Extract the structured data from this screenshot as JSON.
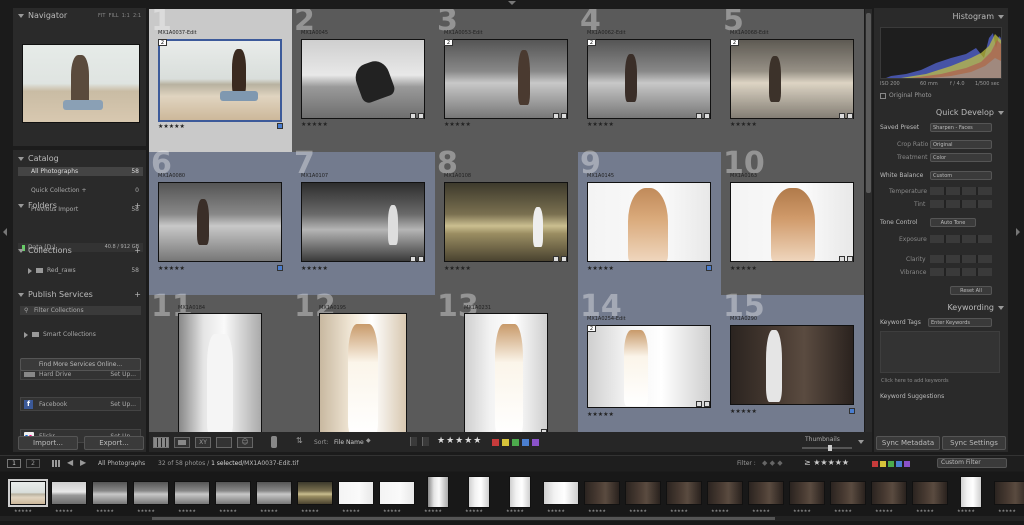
{
  "navigator": {
    "title": "Navigator",
    "fit": "FIT",
    "fill": "FILL",
    "one": "1:1",
    "two": "2:1"
  },
  "catalog": {
    "title": "Catalog",
    "items": [
      {
        "label": "All Photographs",
        "count": "58"
      },
      {
        "label": "Quick Collection +",
        "count": "0"
      },
      {
        "label": "Previous Import",
        "count": "58"
      }
    ]
  },
  "folders": {
    "title": "Folders",
    "drive": "Data (D:)",
    "drive_size": "40.8 / 912 GB",
    "folder": "Red_raws",
    "folder_count": "58"
  },
  "collections": {
    "title": "Collections",
    "filter": "Filter Collections",
    "smart": "Smart Collections"
  },
  "publish": {
    "title": "Publish Services",
    "services": [
      {
        "label": "Hard Drive",
        "action": "Set Up..."
      },
      {
        "label": "Facebook",
        "action": "Set Up..."
      },
      {
        "label": "Flickr",
        "action": "Set Up..."
      }
    ],
    "find_more": "Find More Services Online..."
  },
  "left_buttons": {
    "import": "Import...",
    "export": "Export..."
  },
  "grid": {
    "cells": [
      {
        "num": "1",
        "name": "MX1A0037-Edit",
        "badge": "2",
        "stars": "★★★★★"
      },
      {
        "num": "2",
        "name": "MX1A0045",
        "badge": "",
        "stars": "★★★★★"
      },
      {
        "num": "3",
        "name": "MX1A0053-Edit",
        "badge": "2",
        "stars": "★★★★★"
      },
      {
        "num": "4",
        "name": "MX1A0062-Edit",
        "badge": "2",
        "stars": "★★★★★"
      },
      {
        "num": "5",
        "name": "MX1A0068-Edit",
        "badge": "2",
        "stars": "★★★★★"
      },
      {
        "num": "6",
        "name": "MX1A0080",
        "badge": "",
        "stars": "★★★★★"
      },
      {
        "num": "7",
        "name": "MX1A0107",
        "badge": "",
        "stars": "★★★★★"
      },
      {
        "num": "8",
        "name": "MX1A0108",
        "badge": "",
        "stars": "★★★★★"
      },
      {
        "num": "9",
        "name": "MX1A0145",
        "badge": "",
        "stars": "★★★★★"
      },
      {
        "num": "10",
        "name": "MX1A0163",
        "badge": "",
        "stars": "★★★★★"
      },
      {
        "num": "11",
        "name": "MX1A0184",
        "badge": "",
        "stars": "★★★★★"
      },
      {
        "num": "12",
        "name": "MX1A0195",
        "badge": "",
        "stars": "★★★★★"
      },
      {
        "num": "13",
        "name": "MX1A0231",
        "badge": "",
        "stars": "★★★★★"
      },
      {
        "num": "14",
        "name": "MX1A0254-Edit",
        "badge": "2",
        "stars": "★★★★★"
      },
      {
        "num": "15",
        "name": "MX1A0290",
        "badge": "",
        "stars": "★★★★★"
      }
    ]
  },
  "toolbar": {
    "sort_label": "Sort:",
    "sort_value": "File Name",
    "rating": "★★★★★",
    "thumbnails": "Thumbnails"
  },
  "histogram": {
    "title": "Histogram",
    "iso": "ISO 200",
    "focal": "60 mm",
    "aperture": "f / 4.0",
    "shutter": "1/500 sec",
    "original": "Original Photo"
  },
  "quick_develop": {
    "title": "Quick Develop",
    "saved_preset_label": "Saved Preset",
    "saved_preset": "Sharpen - Faces",
    "crop_label": "Crop Ratio",
    "crop": "Original",
    "treatment_label": "Treatment",
    "treatment": "Color",
    "wb_label": "White Balance",
    "wb": "Custom",
    "temp_label": "Temperature",
    "tint_label": "Tint",
    "tone_label": "Tone Control",
    "auto_tone": "Auto Tone",
    "exposure_label": "Exposure",
    "clarity_label": "Clarity",
    "vibrance_label": "Vibrance",
    "reset": "Reset All"
  },
  "keywording": {
    "title": "Keywording",
    "tags_label": "Keyword Tags",
    "tags_value": "Enter Keywords",
    "hint": "Click here to add keywords",
    "suggestions": "Keyword Suggestions"
  },
  "sync": {
    "metadata": "Sync Metadata",
    "settings": "Sync Settings"
  },
  "filmstrip": {
    "source": "All Photographs",
    "count": "32 of 58 photos /",
    "selected": "1 selected",
    "path": "/MX1A0037-Edit.tif",
    "filter_label": "Filter :",
    "filter_value": "Custom Filter",
    "view1": "1",
    "view2": "2"
  },
  "colors": {
    "accent": "#f1f1f1",
    "selected_cell": "#c9c9c9",
    "blue_cell": "#737b8e",
    "gray_cell": "#5a5a5a"
  }
}
